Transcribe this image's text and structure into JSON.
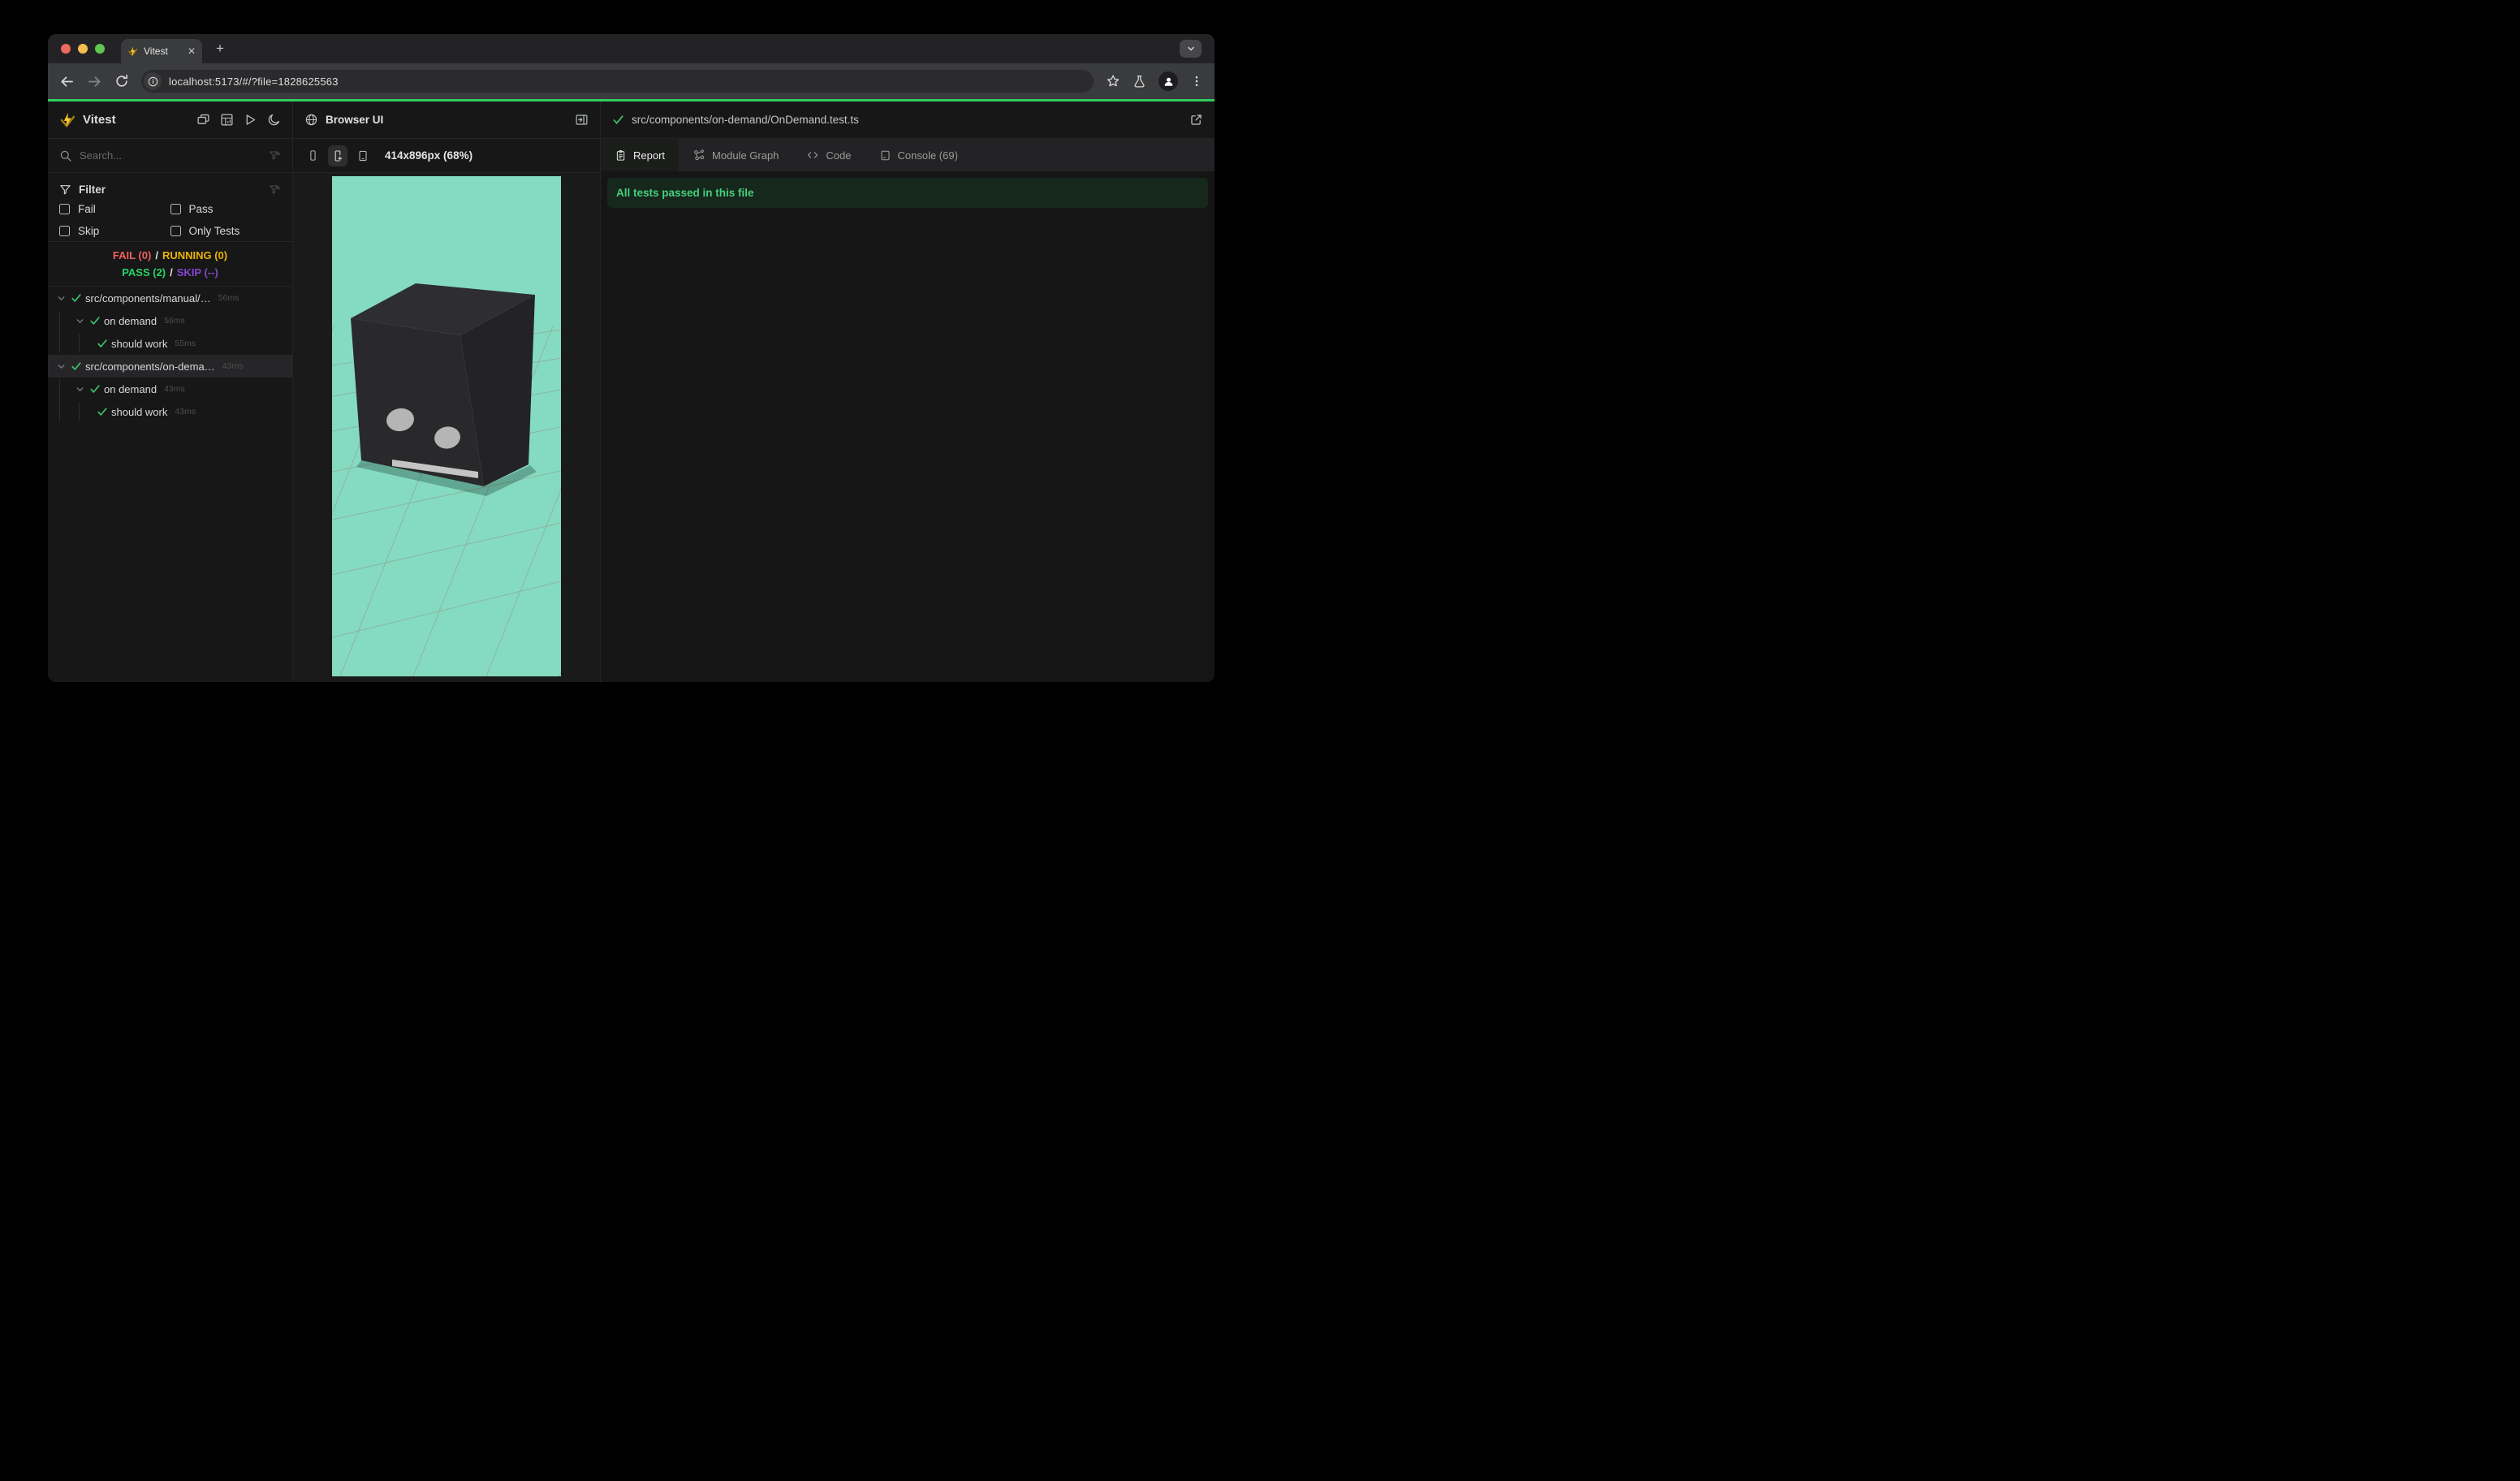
{
  "browser": {
    "tab_title": "Vitest",
    "tab_close": "✕",
    "new_tab_label": "+",
    "url": "localhost:5173/#/?file=1828625563",
    "traffic_lights": {
      "red": "#ee6a5f",
      "yellow": "#f5bd4f",
      "green": "#61c554"
    },
    "progress_color": "#2fce5f"
  },
  "sidebar": {
    "app_title": "Vitest",
    "search_placeholder": "Search...",
    "filter": {
      "title": "Filter",
      "options": [
        {
          "label": "Fail"
        },
        {
          "label": "Pass"
        },
        {
          "label": "Skip"
        },
        {
          "label": "Only Tests"
        }
      ]
    },
    "summary": {
      "fail": "FAIL (0)",
      "running": "RUNNING (0)",
      "pass": "PASS (2)",
      "skip": "SKIP (--)",
      "separator": "/"
    },
    "tree": [
      {
        "label": "src/components/manual/…",
        "duration": "56ms",
        "level": 0,
        "selected": false
      },
      {
        "label": "on demand",
        "duration": "56ms",
        "level": 1,
        "selected": false
      },
      {
        "label": "should work",
        "duration": "55ms",
        "level": 2,
        "selected": false
      },
      {
        "label": "src/components/on-dema…",
        "duration": "43ms",
        "level": 0,
        "selected": true
      },
      {
        "label": "on demand",
        "duration": "43ms",
        "level": 1,
        "selected": false
      },
      {
        "label": "should work",
        "duration": "43ms",
        "level": 2,
        "selected": false
      }
    ]
  },
  "browser_panel": {
    "title": "Browser UI",
    "viewport_label": "414x896px (68%)"
  },
  "test_panel": {
    "file_path": "src/components/on-demand/OnDemand.test.ts",
    "tabs": [
      {
        "label": "Report",
        "active": true
      },
      {
        "label": "Module Graph",
        "active": false
      },
      {
        "label": "Code",
        "active": false
      },
      {
        "label": "Console (69)",
        "active": false
      }
    ],
    "banner_text": "All tests passed in this file"
  },
  "colors": {
    "pass_green": "#3fc56f",
    "fail_red": "#f25f5f",
    "running_amber": "#eab306",
    "skip_purple": "#8447cf",
    "viewport_mint": "#85dbc0",
    "banner_bg": "#16271b",
    "banner_text": "#46cf7d",
    "cube_front": "#29292b",
    "cube_top": "#2e2e30",
    "cube_right": "#232325"
  }
}
